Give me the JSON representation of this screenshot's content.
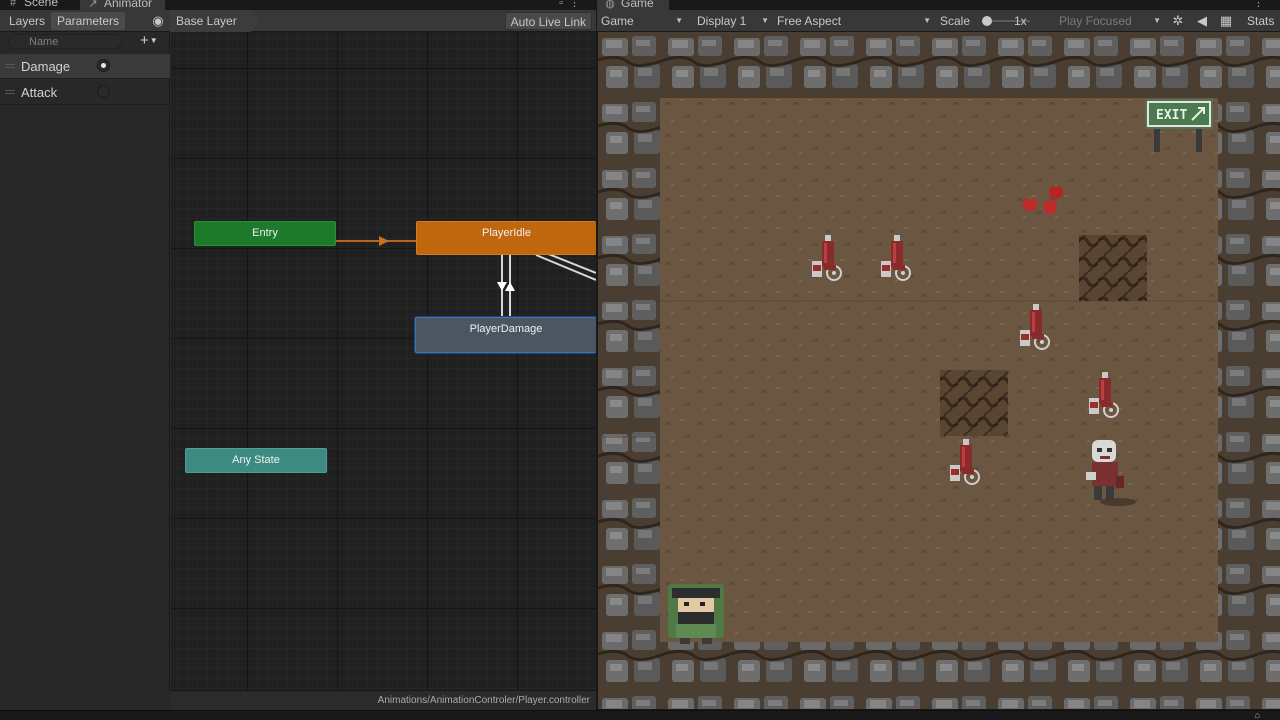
{
  "animator": {
    "tabs": [
      {
        "label": "Scene",
        "icon": "grid-icon"
      },
      {
        "label": "Animator",
        "icon": "animator-icon"
      }
    ],
    "toolbar": {
      "layers_tab": "Layers",
      "parameters_tab": "Parameters",
      "breadcrumb": "Base Layer",
      "auto_live_link": "Auto Live Link"
    },
    "parameters": {
      "search_placeholder": "Name",
      "items": [
        {
          "name": "Damage",
          "type": "trigger",
          "value": true
        },
        {
          "name": "Attack",
          "type": "trigger",
          "value": false
        }
      ]
    },
    "graph": {
      "nodes": {
        "entry": "Entry",
        "idle": "PlayerIdle",
        "damage": "PlayerDamage",
        "any_state": "Any State"
      }
    },
    "footer_path": "Animations/AnimationControler/Player.controller"
  },
  "game": {
    "tab": {
      "label": "Game",
      "icon": "gamepad-icon"
    },
    "toolbar": {
      "view": "Game",
      "display": "Display 1",
      "aspect": "Free Aspect",
      "scale_label": "Scale",
      "scale_value": "1x",
      "play_mode": "Play Focused",
      "stats": "Stats"
    },
    "scene": {
      "exit_sign": "EXIT"
    }
  },
  "colors": {
    "entry": "#1c7a2a",
    "idle": "#c0660f",
    "damage": "#4b5662",
    "any_state": "#3d8b80",
    "dirt": "#6b5641"
  }
}
